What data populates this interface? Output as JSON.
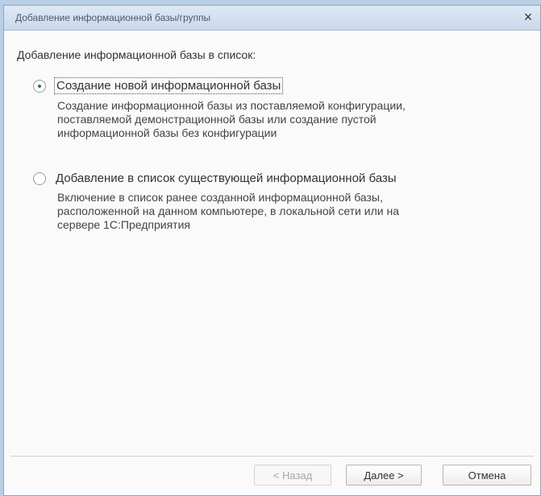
{
  "window": {
    "title": "Добавление информационной базы/группы",
    "close_glyph": "×"
  },
  "content": {
    "prompt": "Добавление информационной базы в список:",
    "options": [
      {
        "label": "Создание новой информационной базы",
        "selected": true,
        "description_lines": [
          "Создание информационной базы из поставляемой конфигурации,",
          "поставляемой демонстрационной базы или создание пустой",
          "информационной базы без конфигурации"
        ]
      },
      {
        "label": "Добавление в список существующей информационной базы",
        "selected": false,
        "description_lines": [
          "Включение в список ранее созданной информационной базы,",
          "расположенной на данном компьютере,  в локальной сети или на",
          "сервере 1С:Предприятия"
        ]
      }
    ]
  },
  "buttons": {
    "back": "< Назад",
    "next": "Далее >",
    "cancel": "Отмена"
  }
}
